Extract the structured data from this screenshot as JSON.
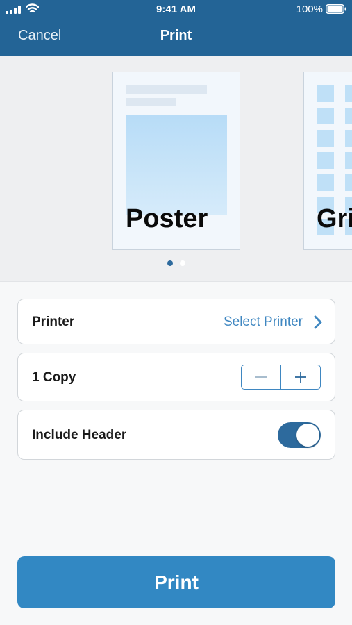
{
  "status_bar": {
    "time": "9:41 AM",
    "battery": "100%",
    "icons": [
      "signal-icon",
      "wifi-icon",
      "battery-icon"
    ]
  },
  "nav": {
    "cancel_label": "Cancel",
    "title": "Print"
  },
  "preview": {
    "cards": [
      {
        "label": "Poster",
        "layout": "poster"
      },
      {
        "label": "Grid",
        "layout": "grid"
      }
    ],
    "page_count": 2,
    "active_page": 1
  },
  "settings": {
    "printer": {
      "label": "Printer",
      "value": "Select Printer",
      "icon": "chevron-right-icon"
    },
    "copies": {
      "label": "1 Copy",
      "count": 1,
      "decrement_icon": "minus-icon",
      "increment_icon": "plus-icon"
    },
    "include_header": {
      "label": "Include Header",
      "enabled": true
    }
  },
  "print_button": {
    "label": "Print"
  },
  "colors": {
    "header": "#236496",
    "accent": "#3f87c1",
    "button": "#3288c3",
    "toggle_on": "#2d6a9d"
  }
}
